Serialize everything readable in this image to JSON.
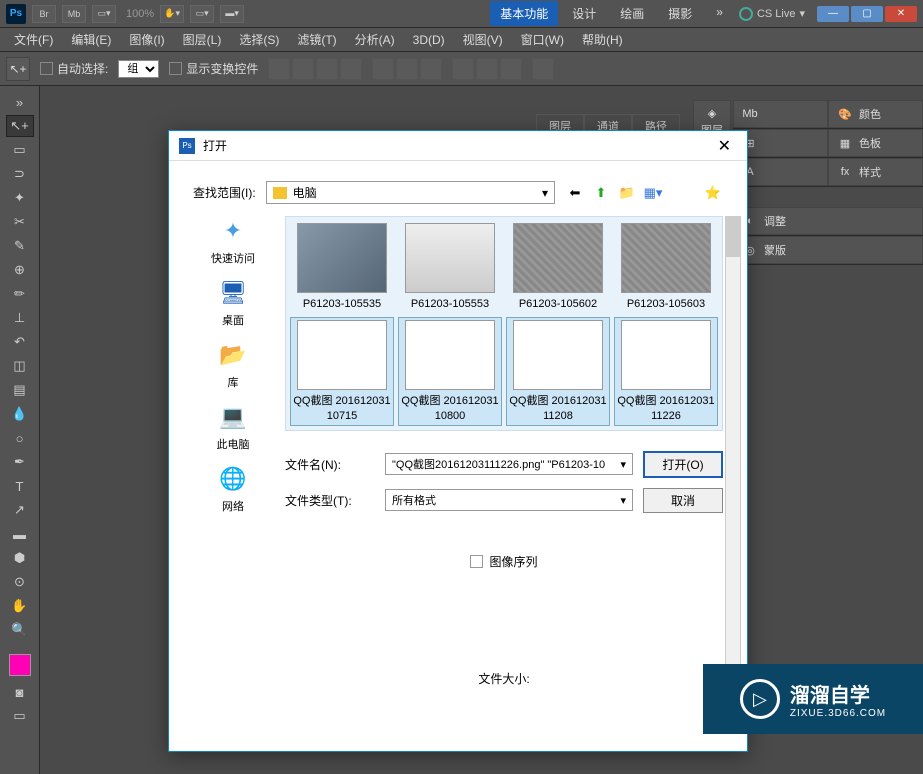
{
  "top_bar": {
    "ps": "Ps",
    "br": "Br",
    "mb": "Mb",
    "zoom": "100%",
    "tabs": [
      "基本功能",
      "设计",
      "绘画",
      "摄影"
    ],
    "more": "»",
    "cs_live": "CS Live"
  },
  "menu": [
    "文件(F)",
    "编辑(E)",
    "图像(I)",
    "图层(L)",
    "选择(S)",
    "滤镜(T)",
    "分析(A)",
    "3D(D)",
    "视图(V)",
    "窗口(W)",
    "帮助(H)"
  ],
  "options": {
    "auto_select": "自动选择:",
    "group": "组",
    "show_transform": "显示变换控件"
  },
  "doc_tabs": [
    "图层",
    "通道",
    "路径"
  ],
  "panel_strip": [
    {
      "label": "图层"
    },
    {
      "label": "通道"
    },
    {
      "label": "路径"
    }
  ],
  "right_panels": [
    [
      {
        "icon": "Mb",
        "label": ""
      },
      {
        "icon": "🎨",
        "label": "颜色"
      }
    ],
    [
      {
        "icon": "",
        "label": ""
      },
      {
        "icon": "▦",
        "label": "色板"
      }
    ],
    [
      {
        "icon": "",
        "label": ""
      },
      {
        "icon": "fx",
        "label": "样式"
      }
    ],
    [
      {
        "icon": "◐",
        "label": "调整"
      }
    ],
    [
      {
        "icon": "◎",
        "label": "蒙版"
      }
    ]
  ],
  "dialog": {
    "title": "打开",
    "lookup_label": "查找范围(I):",
    "lookup_value": "电脑",
    "places": [
      {
        "icon": "★",
        "label": "快速访问",
        "color": "#4a9de0"
      },
      {
        "icon": "🖥",
        "label": "桌面",
        "color": "#1a5fb4"
      },
      {
        "icon": "📁",
        "label": "库",
        "color": "#f4c430"
      },
      {
        "icon": "💻",
        "label": "此电脑",
        "color": "#5a8cc7"
      },
      {
        "icon": "🌐",
        "label": "网络",
        "color": "#1a5fb4"
      }
    ],
    "files": [
      {
        "name": "P61203-105535",
        "type": "photo"
      },
      {
        "name": "P61203-105553",
        "type": "device"
      },
      {
        "name": "P61203-105602",
        "type": "label"
      },
      {
        "name": "P61203-105603",
        "type": "label"
      },
      {
        "name": "QQ截图\n20161203110715",
        "type": "screen",
        "selected": true
      },
      {
        "name": "QQ截图\n20161203110800",
        "type": "screen",
        "selected": true
      },
      {
        "name": "QQ截图\n20161203111208",
        "type": "screen",
        "selected": true
      },
      {
        "name": "QQ截图\n20161203111226",
        "type": "screen",
        "selected": true
      }
    ],
    "filename_label": "文件名(N):",
    "filename_value": "\"QQ截图20161203111226.png\" \"P61203-10",
    "filetype_label": "文件类型(T):",
    "filetype_value": "所有格式",
    "open_btn": "打开(O)",
    "cancel_btn": "取消",
    "image_seq": "图像序列",
    "file_size": "文件大小:"
  },
  "watermark": {
    "title": "溜溜自学",
    "sub": "ZIXUE.3D66.COM"
  }
}
